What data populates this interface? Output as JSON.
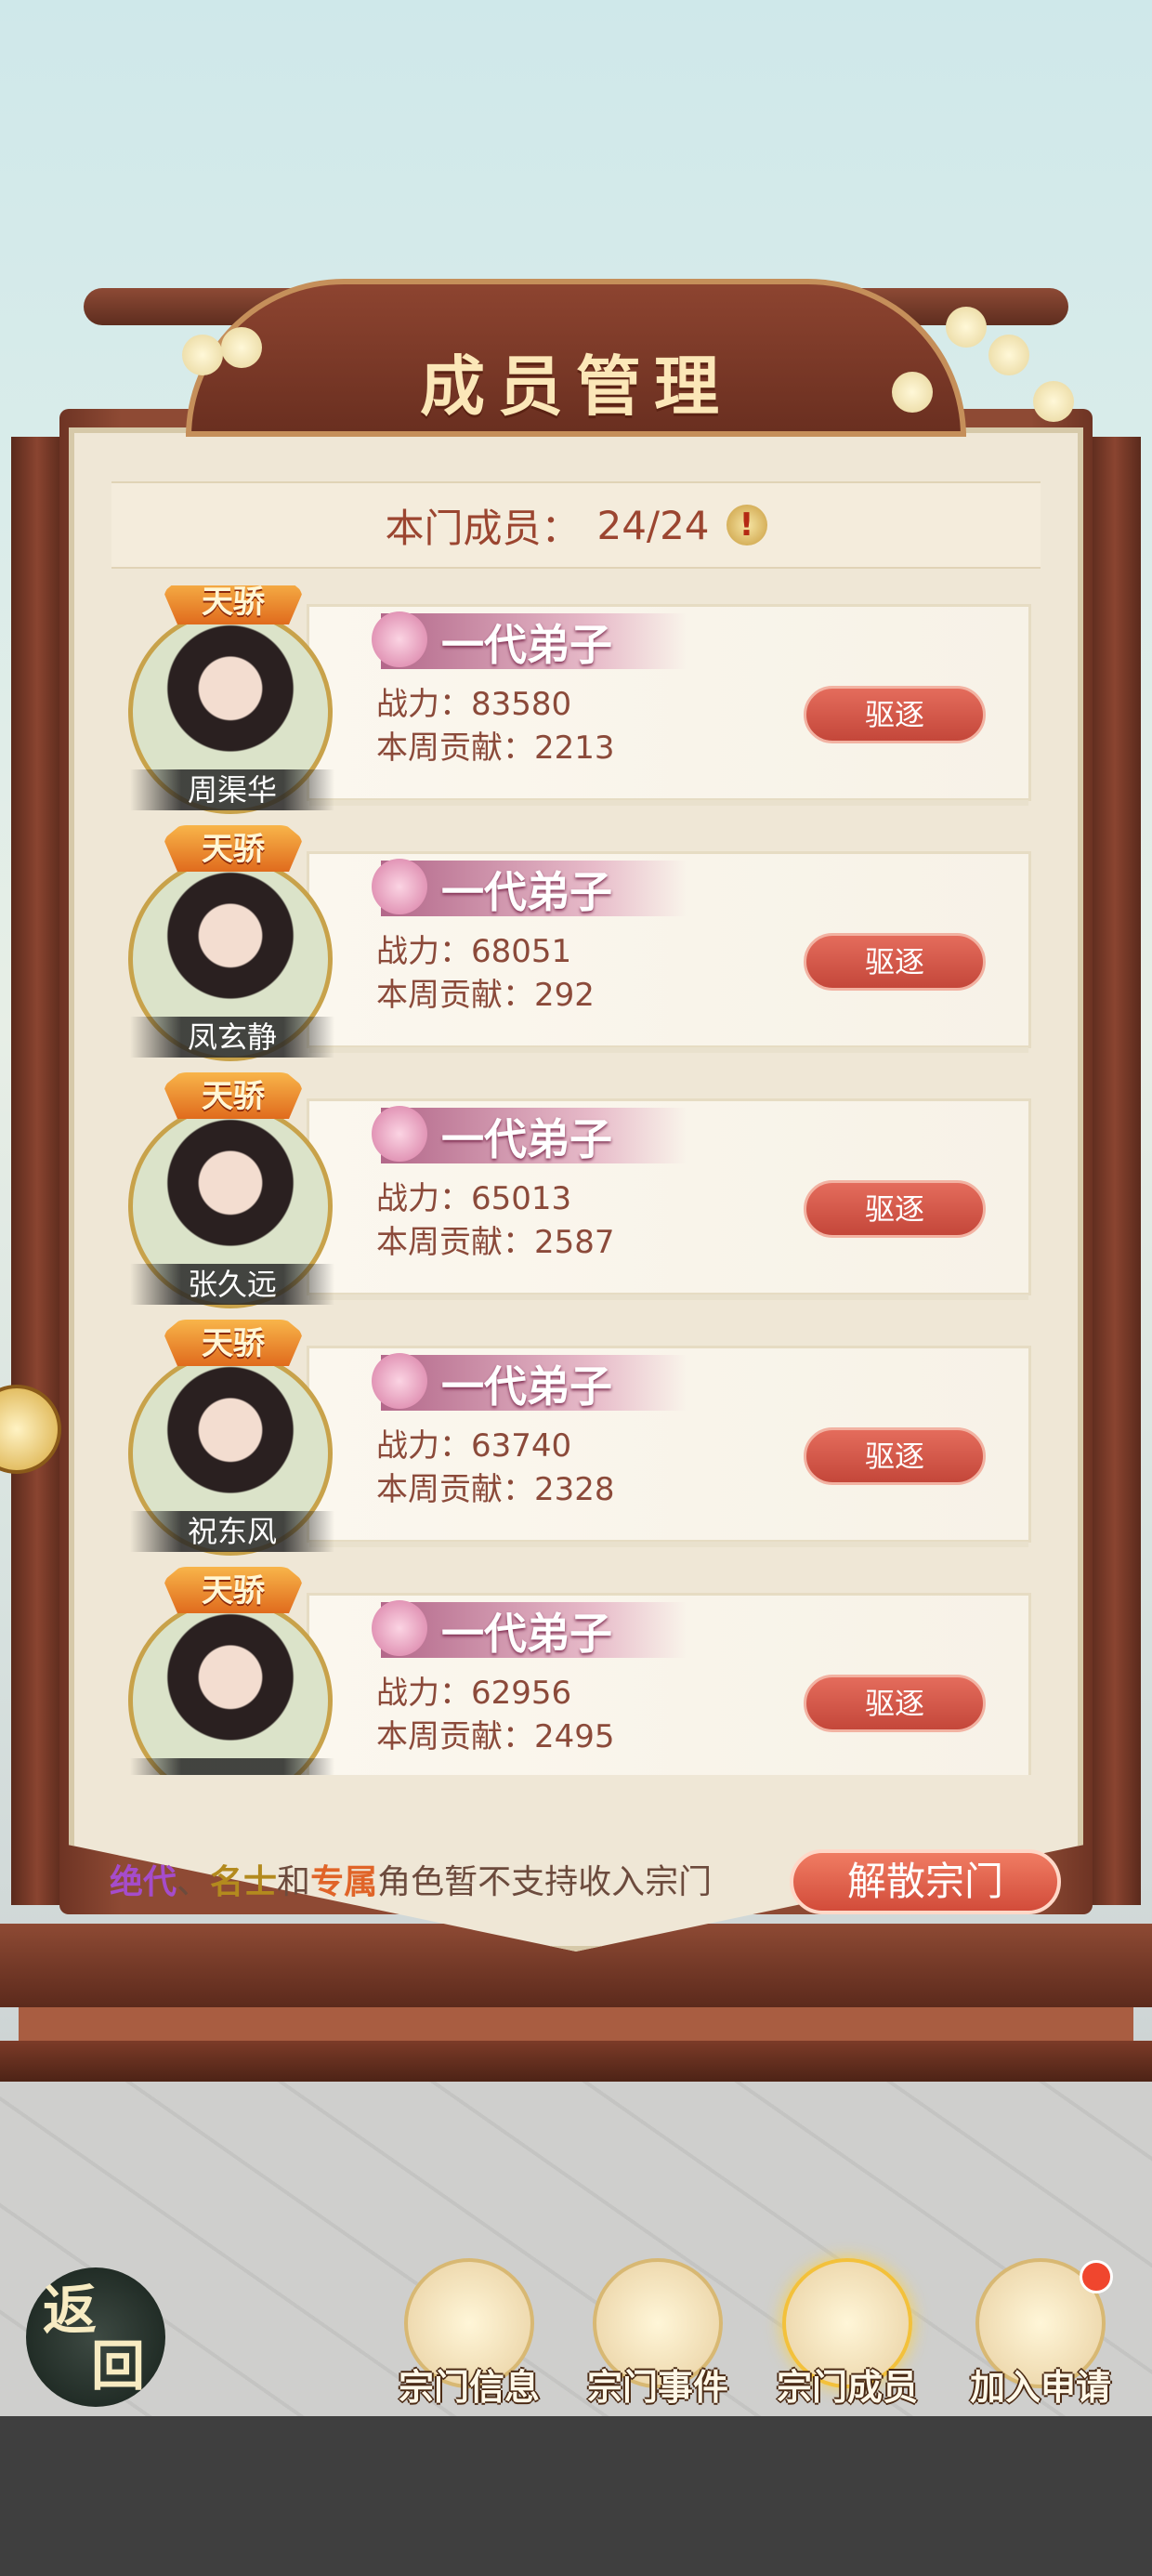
{
  "header": {
    "title": "成员管理",
    "member_label": "本门成员：",
    "member_count": "24/24",
    "info_icon": "!"
  },
  "members": [
    {
      "badge": "天骄",
      "name": "周渠华",
      "rank": "一代弟子",
      "power": "战力：83580",
      "contribution": "本周贡献：2213",
      "action": "驱逐"
    },
    {
      "badge": "天骄",
      "name": "凤玄静",
      "rank": "一代弟子",
      "power": "战力：68051",
      "contribution": "本周贡献：292",
      "action": "驱逐"
    },
    {
      "badge": "天骄",
      "name": "张久远",
      "rank": "一代弟子",
      "power": "战力：65013",
      "contribution": "本周贡献：2587",
      "action": "驱逐"
    },
    {
      "badge": "天骄",
      "name": "祝东风",
      "rank": "一代弟子",
      "power": "战力：63740",
      "contribution": "本周贡献：2328",
      "action": "驱逐"
    },
    {
      "badge": "天骄",
      "name": "",
      "rank": "一代弟子",
      "power": "战力：62956",
      "contribution": "本周贡献：2495",
      "action": "驱逐"
    }
  ],
  "footer": {
    "tag1": "绝代",
    "sep1": "、",
    "tag2": "名士",
    "sep2": "和",
    "tag3": "专属",
    "notice_rest": "角色暂不支持收入宗门",
    "disband": "解散宗门"
  },
  "nav": {
    "back_1": "返",
    "back_2": "回",
    "items": [
      {
        "label": "宗门信息",
        "icon": "scroll-icon"
      },
      {
        "label": "宗门事件",
        "icon": "brush-icon"
      },
      {
        "label": "宗门成员",
        "icon": "members-icon"
      },
      {
        "label": "加入申请",
        "icon": "book-icon"
      }
    ],
    "active_index": 2
  },
  "colors": {
    "accent": "#c4473a",
    "brown": "#8e4a34",
    "text": "#8b4a3a"
  }
}
